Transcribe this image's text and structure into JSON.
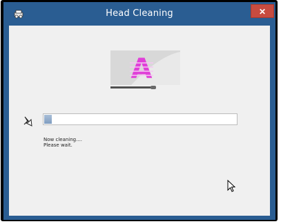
{
  "window": {
    "title": "Head Cleaning",
    "close_label": "✕"
  },
  "progress": {
    "value_fraction": 0.04
  },
  "status": {
    "line1": "Now cleaning....",
    "line2": "Please wait."
  },
  "illustration": {
    "letter": "A",
    "letter_color": "#e040d8"
  },
  "icons": {
    "title": "printer-icon",
    "status": "cleaning-nozzle-icon",
    "cursor": "mouse-pointer-icon"
  }
}
